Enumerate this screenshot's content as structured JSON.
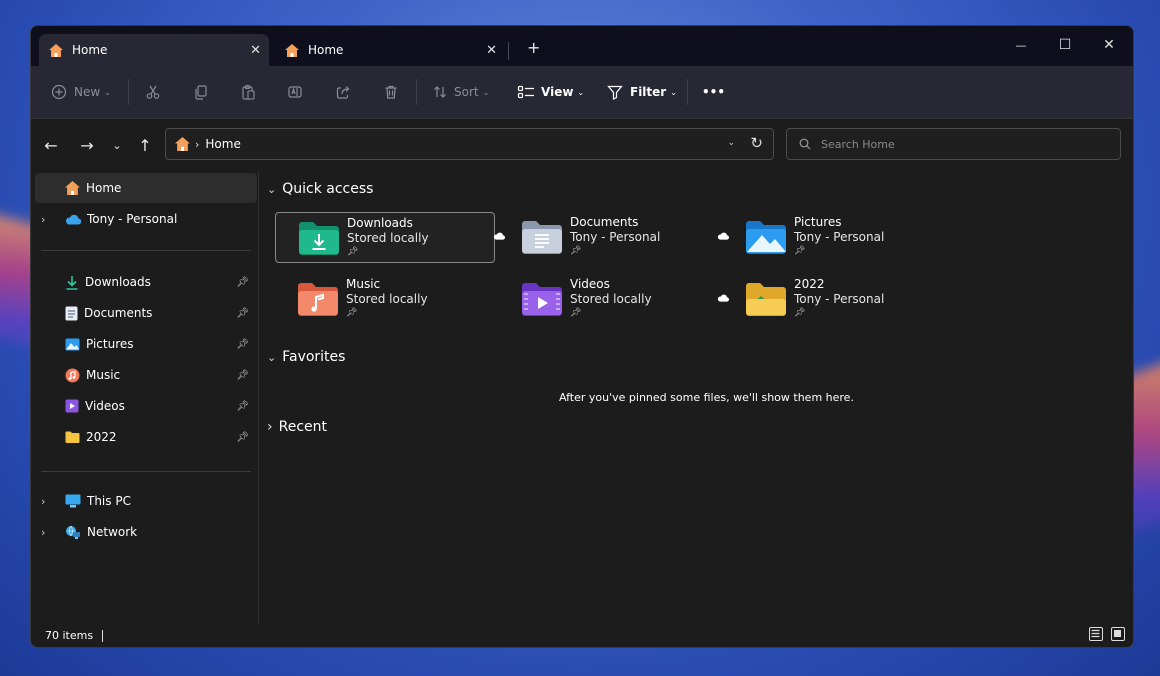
{
  "tabs": [
    {
      "label": "Home",
      "active": true
    },
    {
      "label": "Home",
      "active": false
    }
  ],
  "window_controls": {
    "minimize": "—",
    "maximize": "☐",
    "close": "✕"
  },
  "commands": {
    "new": "New",
    "sort": "Sort",
    "view": "View",
    "filter": "Filter",
    "more": "•••"
  },
  "address": {
    "crumb": "Home"
  },
  "search": {
    "placeholder": "Search Home"
  },
  "sidebar": {
    "top": [
      {
        "label": "Home",
        "selected": true
      },
      {
        "label": "Tony - Personal"
      }
    ],
    "pinned": [
      {
        "label": "Downloads"
      },
      {
        "label": "Documents"
      },
      {
        "label": "Pictures"
      },
      {
        "label": "Music"
      },
      {
        "label": "Videos"
      },
      {
        "label": "2022"
      }
    ],
    "bottom": [
      {
        "label": "This PC"
      },
      {
        "label": "Network"
      }
    ]
  },
  "sections": {
    "quick_access": "Quick access",
    "favorites": "Favorites",
    "recent": "Recent"
  },
  "quick_access": [
    {
      "name": "Downloads",
      "sub": "Stored locally"
    },
    {
      "name": "Documents",
      "sub": "Tony - Personal"
    },
    {
      "name": "Pictures",
      "sub": "Tony - Personal"
    },
    {
      "name": "Music",
      "sub": "Stored locally"
    },
    {
      "name": "Videos",
      "sub": "Stored locally"
    },
    {
      "name": "2022",
      "sub": "Tony - Personal"
    }
  ],
  "favorites_empty": "After you've pinned some files, we'll show them here.",
  "status": {
    "count": "70 items"
  },
  "colors": {
    "accent": "#60cdff",
    "downloads": "#1db48a",
    "pictures": "#2b9cf0",
    "music": "#f07a5a",
    "videos": "#8a55e0",
    "folder": "#f5c542"
  }
}
